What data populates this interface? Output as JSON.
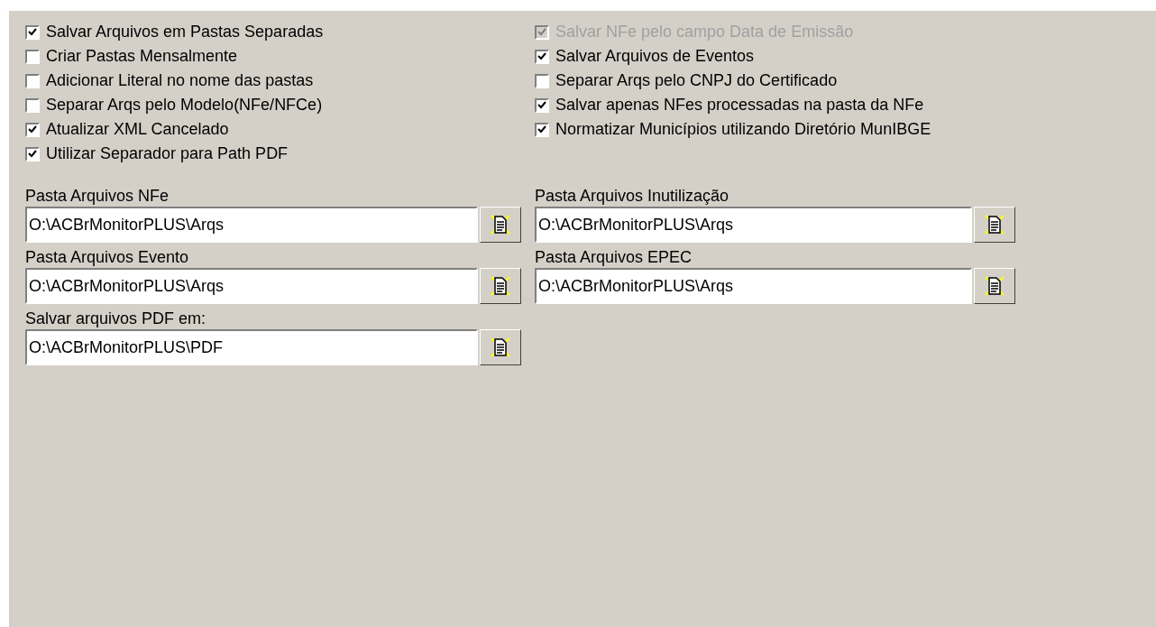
{
  "options_left": [
    {
      "label": "Salvar Arquivos em Pastas Separadas",
      "checked": true,
      "disabled": false
    },
    {
      "label": "Criar Pastas Mensalmente",
      "checked": false,
      "disabled": false
    },
    {
      "label": "Adicionar Literal no nome das pastas",
      "checked": false,
      "disabled": false
    },
    {
      "label": "Separar Arqs pelo Modelo(NFe/NFCe)",
      "checked": false,
      "disabled": false
    },
    {
      "label": "Atualizar XML Cancelado",
      "checked": true,
      "disabled": false
    },
    {
      "label": "Utilizar Separador para Path PDF",
      "checked": true,
      "disabled": false
    }
  ],
  "options_right": [
    {
      "label": "Salvar NFe pelo campo Data de Emissão",
      "checked": true,
      "disabled": true
    },
    {
      "label": "Salvar Arquivos de Eventos",
      "checked": true,
      "disabled": false
    },
    {
      "label": "Separar Arqs pelo CNPJ do Certificado",
      "checked": false,
      "disabled": false
    },
    {
      "label": "Salvar apenas NFes processadas na pasta da NFe",
      "checked": true,
      "disabled": false
    },
    {
      "label": "Normatizar Municípios utilizando Diretório MunIBGE",
      "checked": true,
      "disabled": false
    }
  ],
  "folders": [
    [
      {
        "label": "Pasta Arquivos NFe",
        "value": "O:\\ACBrMonitorPLUS\\Arqs"
      },
      {
        "label": "Pasta Arquivos Inutilização",
        "value": "O:\\ACBrMonitorPLUS\\Arqs"
      }
    ],
    [
      {
        "label": "Pasta Arquivos Evento",
        "value": "O:\\ACBrMonitorPLUS\\Arqs"
      },
      {
        "label": "Pasta Arquivos EPEC",
        "value": "O:\\ACBrMonitorPLUS\\Arqs"
      }
    ],
    [
      {
        "label": "Salvar arquivos PDF em:",
        "value": "O:\\ACBrMonitorPLUS\\PDF"
      }
    ]
  ]
}
